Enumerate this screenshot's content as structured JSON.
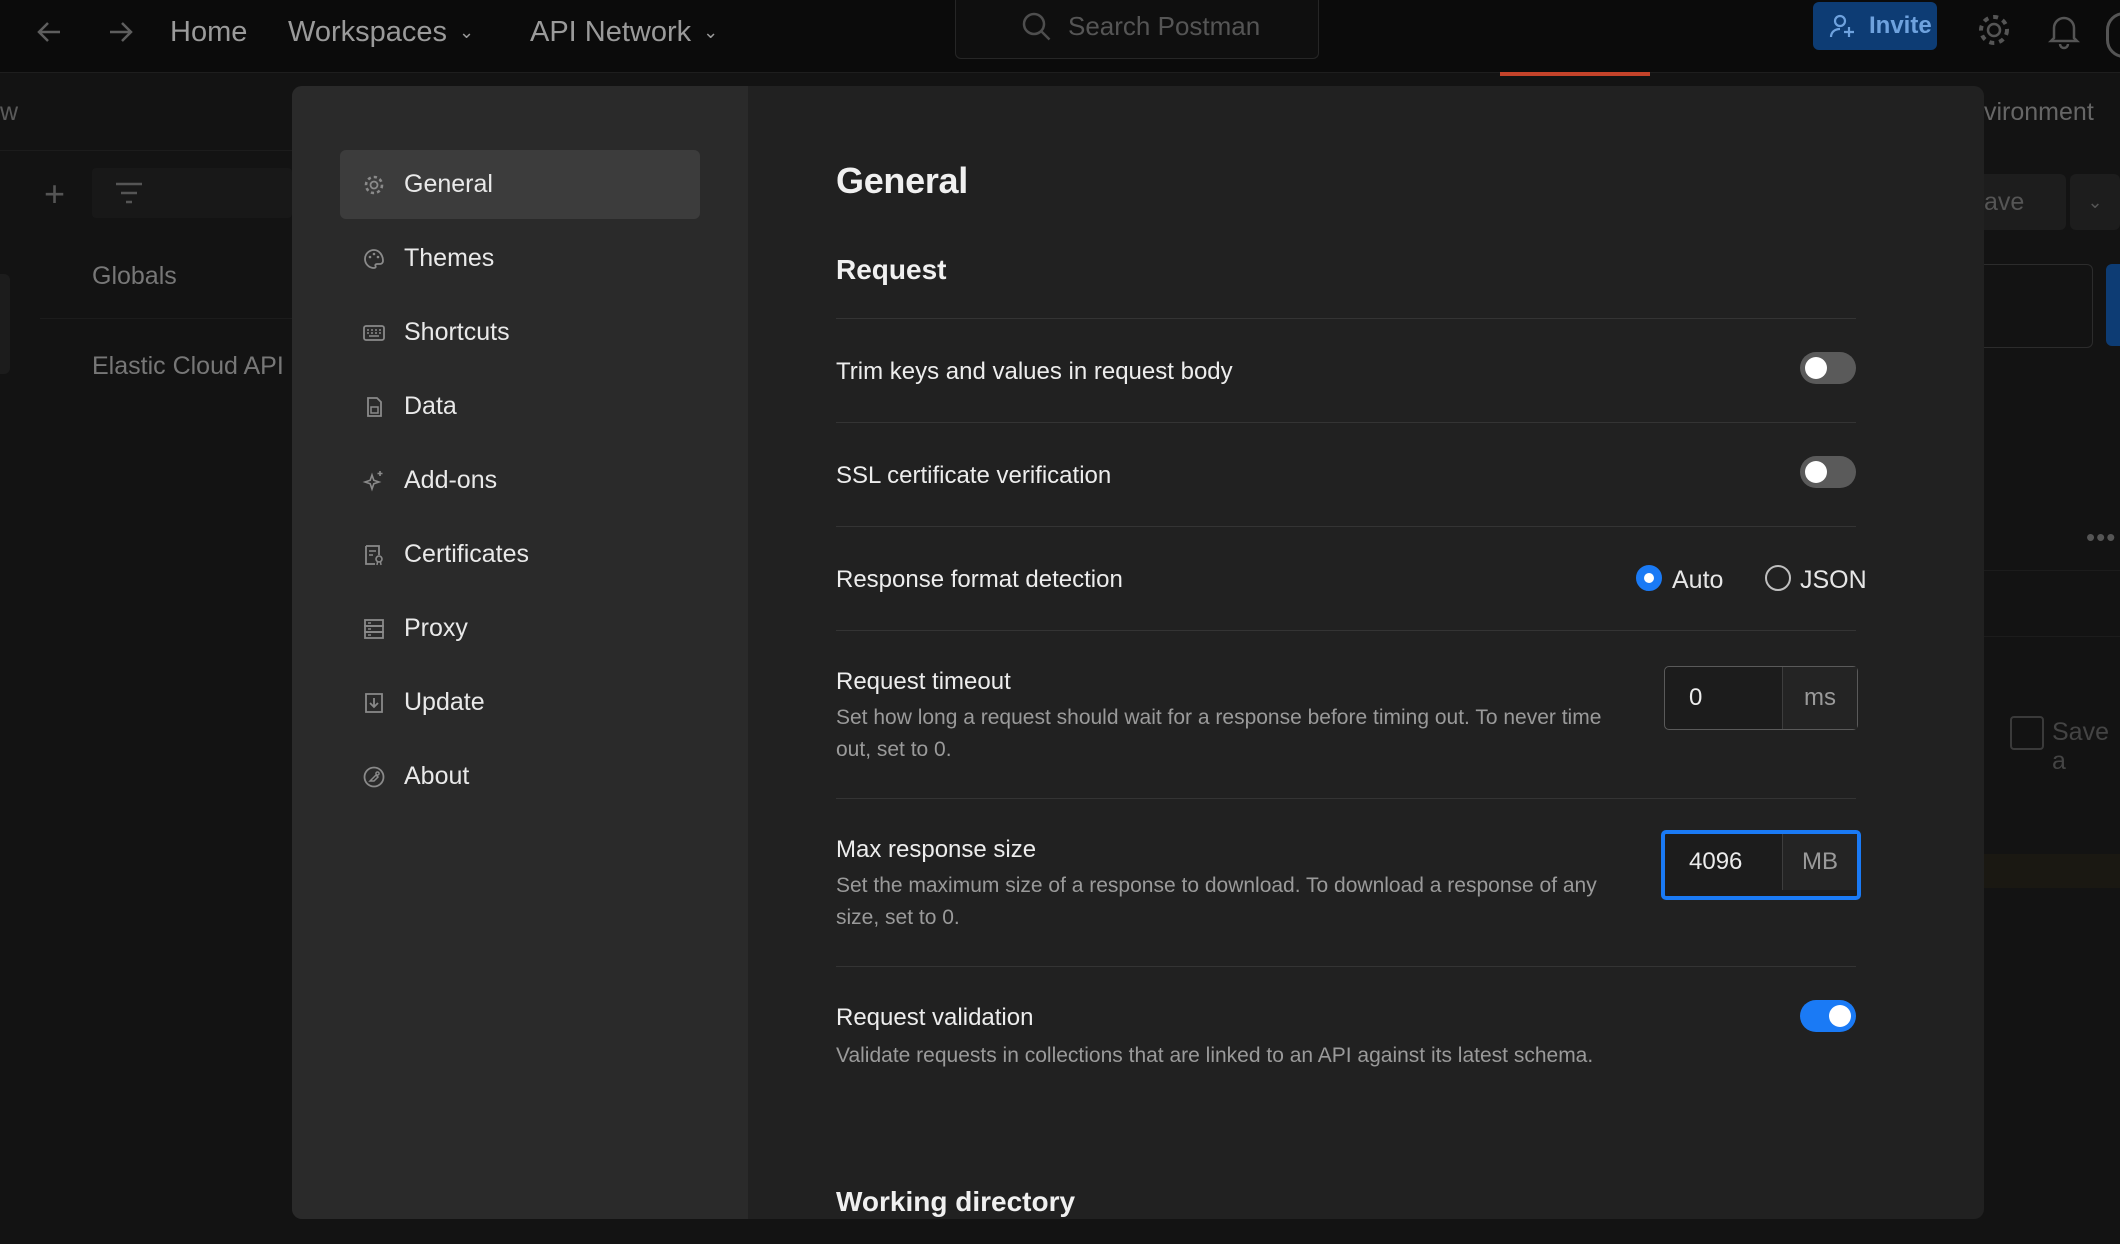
{
  "topbar": {
    "home": "Home",
    "workspaces": "Workspaces",
    "api_network": "API Network",
    "search_placeholder": "Search Postman",
    "invite": "Invite"
  },
  "background": {
    "edge_left": "w",
    "tab_fragment": "vironment",
    "save_fragment": "ave",
    "save_as_fragment": "Save a",
    "list": [
      "Globals",
      "Elastic Cloud API"
    ]
  },
  "settings": {
    "sidebar": [
      {
        "label": "General",
        "icon": "gear-icon",
        "active": true
      },
      {
        "label": "Themes",
        "icon": "palette-icon",
        "active": false
      },
      {
        "label": "Shortcuts",
        "icon": "keyboard-icon",
        "active": false
      },
      {
        "label": "Data",
        "icon": "database-icon",
        "active": false
      },
      {
        "label": "Add-ons",
        "icon": "sparkle-icon",
        "active": false
      },
      {
        "label": "Certificates",
        "icon": "certificate-icon",
        "active": false
      },
      {
        "label": "Proxy",
        "icon": "server-icon",
        "active": false
      },
      {
        "label": "Update",
        "icon": "download-icon",
        "active": false
      },
      {
        "label": "About",
        "icon": "postman-logo-icon",
        "active": false
      }
    ],
    "title": "General",
    "request_section": "Request",
    "trim": {
      "label": "Trim keys and values in request body",
      "enabled": false
    },
    "ssl": {
      "label": "SSL certificate verification",
      "enabled": false
    },
    "format": {
      "label": "Response format detection",
      "options": [
        "Auto",
        "JSON"
      ],
      "selected": "Auto"
    },
    "timeout": {
      "label": "Request timeout",
      "desc": "Set how long a request should wait for a response before timing out. To never time out, set to 0.",
      "value": "0",
      "unit": "ms"
    },
    "max_size": {
      "label": "Max response size",
      "desc": "Set the maximum size of a response to download. To download a response of any size, set to 0.",
      "value": "4096",
      "unit": "MB"
    },
    "validation": {
      "label": "Request validation",
      "desc": "Validate requests in collections that are linked to an API against its latest schema.",
      "enabled": true
    },
    "working_dir_section": "Working directory"
  },
  "colors": {
    "accent": "#1a7af5",
    "modal_bg": "#212121",
    "sidebar_bg": "#2a2a2a",
    "brand_orange": "#c4432a"
  }
}
